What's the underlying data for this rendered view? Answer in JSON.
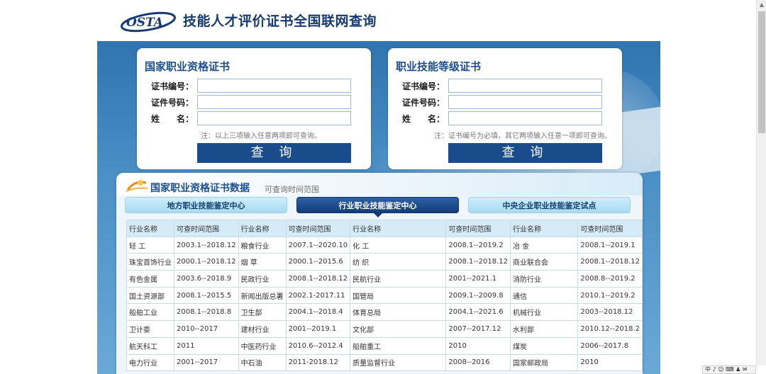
{
  "header": {
    "logo_text": "OSTA",
    "title": "技能人才评价证书全国联网查询"
  },
  "left_panel": {
    "title": "国家职业资格证书",
    "label_cert_no": "证书编号：",
    "label_id_no": "证件号码：",
    "label_name": "姓　　名：",
    "cert_no_value": "",
    "id_no_value": "",
    "name_value": "",
    "note": "注：以上三项输入任意两项即可查询。",
    "button": "查 询"
  },
  "right_panel": {
    "title": "职业技能等级证书",
    "label_cert_no": "证书编号：",
    "label_id_no": "证件号码：",
    "label_name": "姓　　名：",
    "cert_no_value": "",
    "id_no_value": "",
    "name_value": "",
    "note": "注：证书编号为必填，其它两项输入任意一项即可查询。",
    "button": "查 询"
  },
  "data_section": {
    "title": "国家职业资格证书数据",
    "subtitle": "可查询时间范围",
    "tabs": [
      {
        "label": "地方职业技能鉴定中心",
        "active": false
      },
      {
        "label": "行业职业技能鉴定中心",
        "active": true
      },
      {
        "label": "中央企业职业技能鉴定试点",
        "active": false
      }
    ],
    "table": {
      "headers": [
        "行业名称",
        "可查时间范围",
        "行业名称",
        "可查时间范围",
        "行业名称",
        "可查时间范围",
        "行业名称",
        "可查时间范围"
      ],
      "rows": [
        [
          "轻 工",
          "2003.1--2018.12",
          "粮食行业",
          "2007.1--2020.10",
          "化 工",
          "2008.1--2019.2",
          "冶 金",
          "2008.1--2019.1"
        ],
        [
          "珠宝首饰行业",
          "2000.1--2018.12",
          "烟 草",
          "2000.1--2015.6",
          "纺 织",
          "2008.1--2018.12",
          "商业联合会",
          "2008.1--2018.12"
        ],
        [
          "有色金属",
          "2003.6--2018.9",
          "民政行业",
          "2008.1--2018.12",
          "民航行业",
          "2001--2021.1",
          "消防行业",
          "2008.8--2019.2"
        ],
        [
          "国土资源部",
          "2008.1--2015.5",
          "新闻出版总署",
          "2002.1-2017.11",
          "国管局",
          "2009.1--2009.8",
          "通信",
          "2010.1--2019.2"
        ],
        [
          "船舶工业",
          "2008.1--2018.8",
          "卫生部",
          "2004.1--2018.4",
          "体育总局",
          "2004.1--2021.6",
          "机械行业",
          "2003--2018.12"
        ],
        [
          "卫计委",
          "2010--2017",
          "建材行业",
          "2001--2019.1",
          "文化部",
          "2007--2017.12",
          "水利部",
          "2010.12--2018.2"
        ],
        [
          "航天科工",
          "2011",
          "中医药行业",
          "2010.6--2012.4",
          "船舶重工",
          "2010",
          "煤炭",
          "2006--2017.8"
        ],
        [
          "电力行业",
          "2001--2017",
          "中石油",
          "2011-2018.12",
          "质量监督行业",
          "2008--2016",
          "国家邮政局",
          "2010"
        ]
      ]
    }
  },
  "tray": {
    "text": "中 ♪ ☺ ⌨ ♟ ✉"
  },
  "colors": {
    "brand_blue": "#1a4c8c",
    "title_blue": "#1c4f92",
    "banner_blue": "#2f74b0",
    "table_header": "#d5ebf7"
  }
}
